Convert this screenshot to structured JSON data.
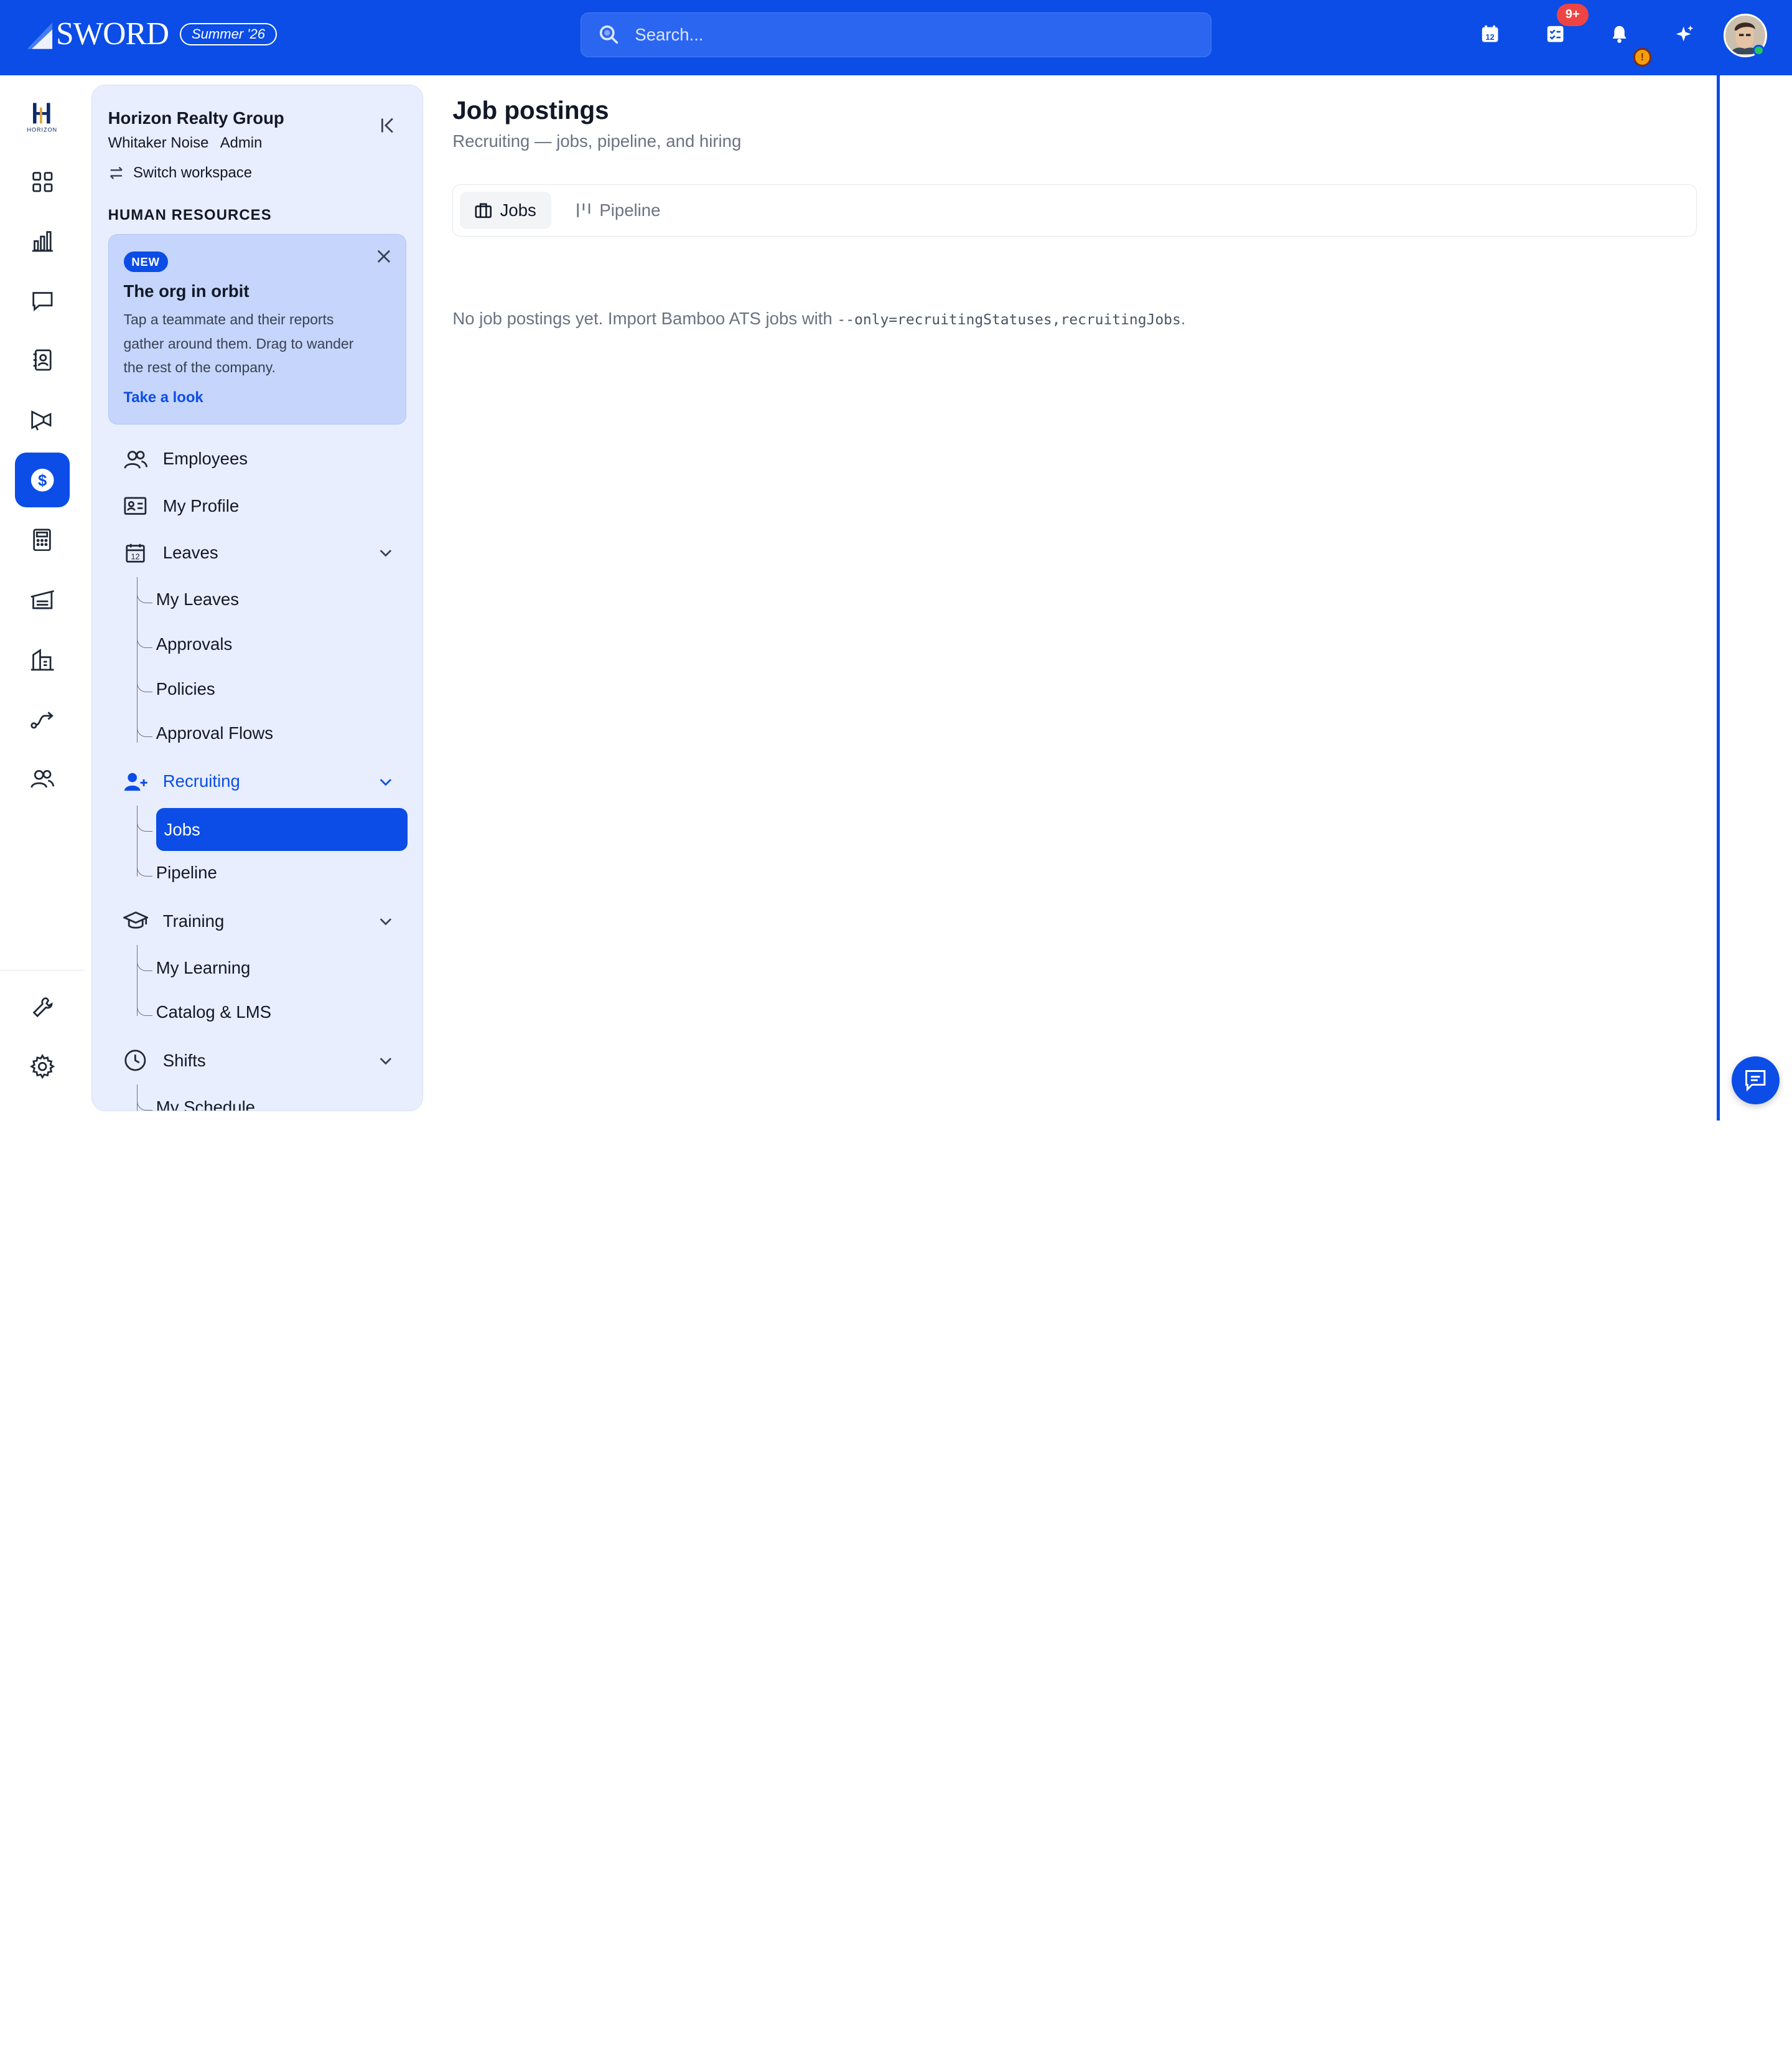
{
  "topbar": {
    "brand": "SWORD",
    "season": "Summer '26",
    "search_placeholder": "Search...",
    "tasks_badge": "9+",
    "bell_badge": "!",
    "calendar_day": "12"
  },
  "org": {
    "name": "Horizon Realty Group",
    "user": "Whitaker Noise",
    "role": "Admin",
    "switch_label": "Switch workspace",
    "logo_text": "HORIZON"
  },
  "sidebar": {
    "section": "HUMAN RESOURCES",
    "promo": {
      "badge": "NEW",
      "title": "The org in orbit",
      "body": "Tap a teammate and their reports gather around them. Drag to wander the rest of the company.",
      "link": "Take a look"
    },
    "items": {
      "employees": "Employees",
      "my_profile": "My Profile",
      "leaves": "Leaves",
      "my_leaves": "My Leaves",
      "approvals": "Approvals",
      "policies": "Policies",
      "approval_flows": "Approval Flows",
      "recruiting": "Recruiting",
      "jobs": "Jobs",
      "pipeline": "Pipeline",
      "training": "Training",
      "my_learning": "My Learning",
      "catalog_lms": "Catalog & LMS",
      "shifts": "Shifts",
      "my_schedule": "My Schedule"
    }
  },
  "main": {
    "title": "Job postings",
    "subtitle": "Recruiting — jobs, pipeline, and hiring",
    "tabs": {
      "jobs": "Jobs",
      "pipeline": "Pipeline"
    },
    "empty_prefix": "No job postings yet. Import Bamboo ATS jobs with ",
    "empty_code": "--only=recruitingStatuses,recruitingJobs",
    "empty_suffix": "."
  },
  "colors": {
    "brand": "#0b4de6",
    "panel": "#e8eefd",
    "promo": "#c6d5fb",
    "badge": "#ef4444"
  }
}
